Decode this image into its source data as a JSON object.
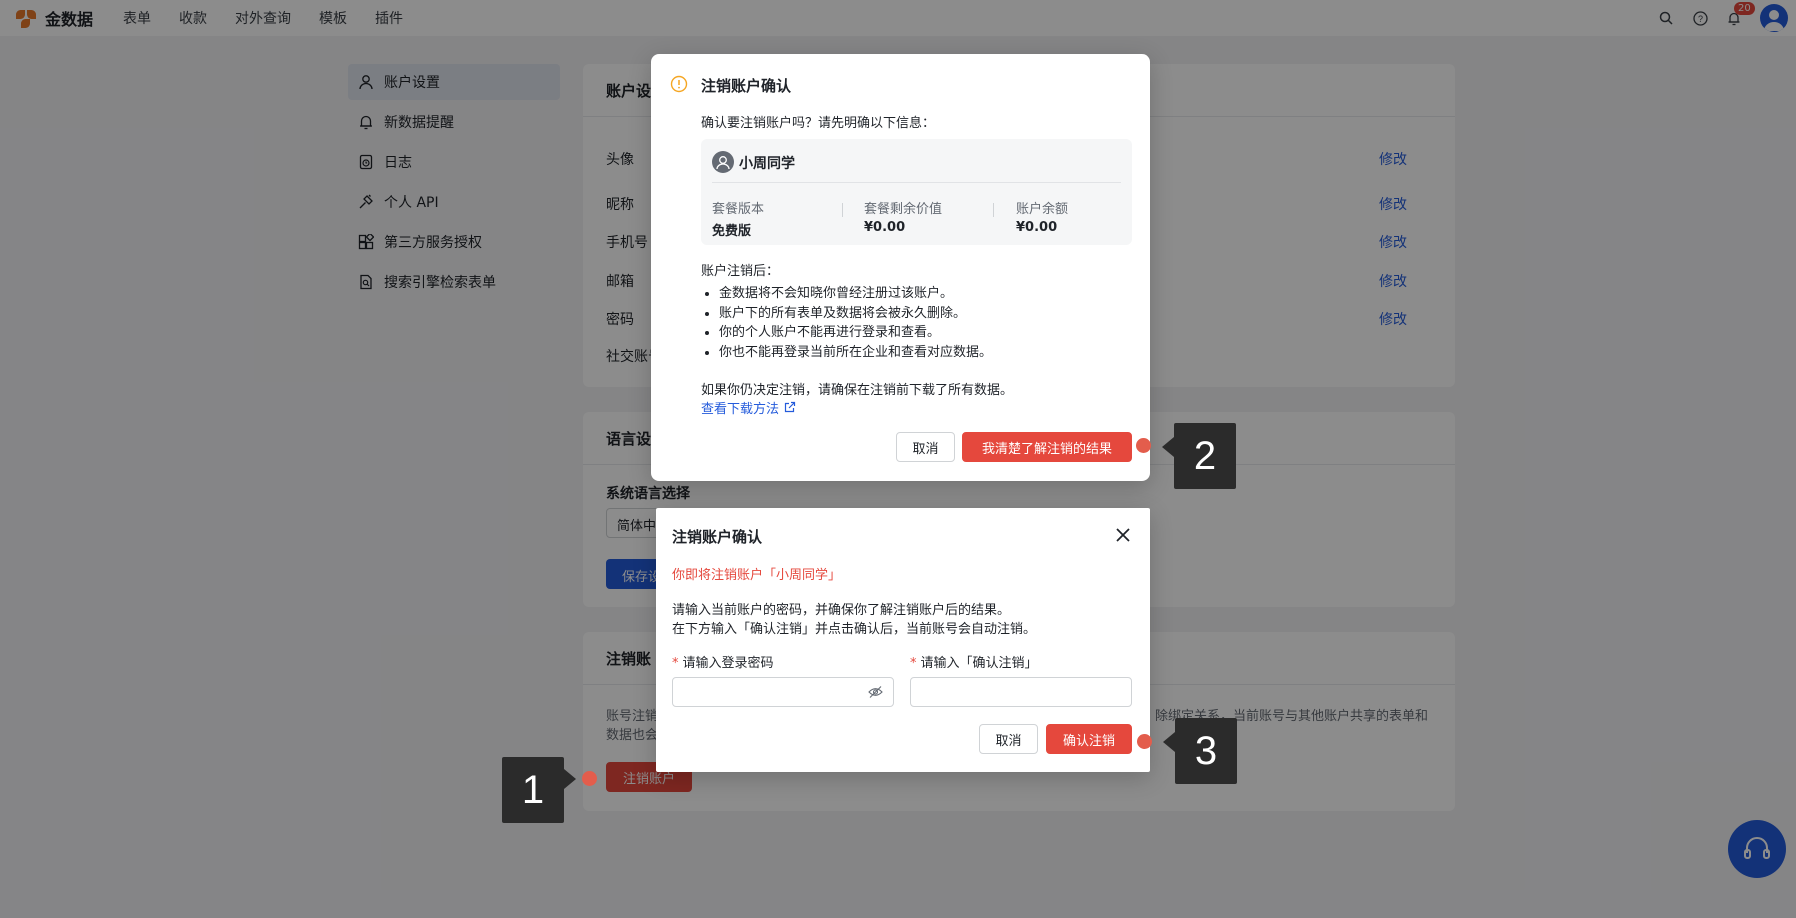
{
  "app": {
    "name": "金数据"
  },
  "nav": {
    "items": [
      "表单",
      "收款",
      "对外查询",
      "模板",
      "插件"
    ]
  },
  "topbar": {
    "notification_count": "20",
    "icons": [
      "search-icon",
      "help-icon",
      "bell-icon",
      "user-avatar"
    ]
  },
  "sidebar": {
    "items": [
      {
        "label": "账户设置",
        "icon": "user-icon",
        "active": true
      },
      {
        "label": "新数据提醒",
        "icon": "bell-icon"
      },
      {
        "label": "日志",
        "icon": "log-icon"
      },
      {
        "label": "个人 API",
        "icon": "plug-icon"
      },
      {
        "label": "第三方服务授权",
        "icon": "apps-icon"
      },
      {
        "label": "搜索引擎检索表单",
        "icon": "search-doc-icon"
      }
    ]
  },
  "account_panel": {
    "title": "账户设",
    "rows": [
      "头像",
      "昵称",
      "手机号",
      "邮箱",
      "密码",
      "社交账号"
    ],
    "edit_label": "修改"
  },
  "language_panel": {
    "title": "语言设",
    "field_label": "系统语言选择",
    "select_value": "简体中",
    "save_label": "保存设"
  },
  "cancel_panel": {
    "title": "注销账",
    "desc_line1": "账号注销",
    "desc_line1_right": "除绑定关系，当前账号与其他账户共享的表单和",
    "desc_line2": "数据也会",
    "button_label": "注销账户"
  },
  "dialog1": {
    "title": "注销账户确认",
    "intro": "确认要注销账户吗？请先明确以下信息：",
    "user_name": "小周同学",
    "stats": [
      {
        "label": "套餐版本",
        "value": "免费版"
      },
      {
        "label": "套餐剩余价值",
        "value": "¥0.00"
      },
      {
        "label": "账户余额",
        "value": "¥0.00"
      }
    ],
    "after_title": "账户注销后：",
    "consequences": [
      "金数据将不会知晓你曾经注册过该账户。",
      "账户下的所有表单及数据将会被永久删除。",
      "你的个人账户不能再进行登录和查看。",
      "你也不能再登录当前所在企业和查看对应数据。"
    ],
    "note": "如果你仍决定注销，请确保在注销前下载了所有数据。",
    "download_link": "查看下载方法",
    "cancel_label": "取消",
    "confirm_label": "我清楚了解注销的结果"
  },
  "dialog2": {
    "title": "注销账户确认",
    "warning": "你即将注销账户「小周同学」",
    "desc_line1": "请输入当前账户的密码，并确保你了解注销账户后的结果。",
    "desc_line2": "在下方输入「确认注销」并点击确认后，当前账号会自动注销。",
    "password_label": "请输入登录密码",
    "confirm_text_label": "请输入「确认注销」",
    "required_mark": "*",
    "cancel_label": "取消",
    "confirm_label": "确认注销"
  },
  "callouts": [
    "1",
    "2",
    "3"
  ]
}
